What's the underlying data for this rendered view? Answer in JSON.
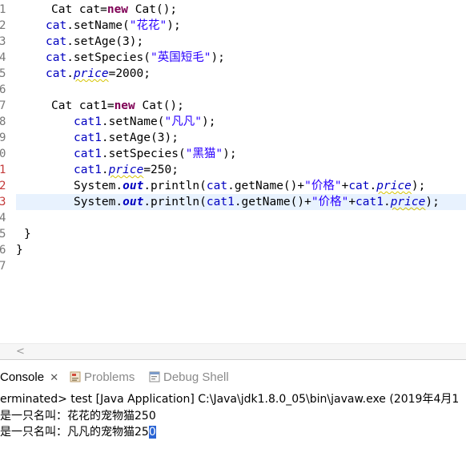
{
  "editor": {
    "lines": [
      {
        "num": "1",
        "numClass": "",
        "cur": false,
        "indent": 64,
        "segs": [
          {
            "t": "Cat cat=",
            "c": ""
          },
          {
            "t": "new",
            "c": "kw"
          },
          {
            "t": " Cat();",
            "c": ""
          }
        ]
      },
      {
        "num": "2",
        "numClass": "",
        "cur": false,
        "indent": 57,
        "segs": [
          {
            "t": "cat",
            "c": "fld"
          },
          {
            "t": ".setName(",
            "c": ""
          },
          {
            "t": "\"花花\"",
            "c": "str"
          },
          {
            "t": ");",
            "c": ""
          }
        ]
      },
      {
        "num": "3",
        "numClass": "",
        "cur": false,
        "indent": 57,
        "segs": [
          {
            "t": "cat",
            "c": "fld"
          },
          {
            "t": ".setAge(3);",
            "c": ""
          }
        ]
      },
      {
        "num": "4",
        "numClass": "",
        "cur": false,
        "indent": 57,
        "segs": [
          {
            "t": "cat",
            "c": "fld"
          },
          {
            "t": ".setSpecies(",
            "c": ""
          },
          {
            "t": "\"英国短毛\"",
            "c": "str"
          },
          {
            "t": ");",
            "c": ""
          }
        ]
      },
      {
        "num": "5",
        "numClass": "",
        "cur": false,
        "indent": 57,
        "segs": [
          {
            "t": "cat",
            "c": "fld"
          },
          {
            "t": ".",
            "c": ""
          },
          {
            "t": "price",
            "c": "fld ital sq"
          },
          {
            "t": "=2000;",
            "c": ""
          }
        ]
      },
      {
        "num": "6",
        "numClass": "",
        "cur": false,
        "indent": 0,
        "segs": []
      },
      {
        "num": "7",
        "numClass": "",
        "cur": false,
        "indent": 64,
        "segs": [
          {
            "t": "Cat cat1=",
            "c": ""
          },
          {
            "t": "new",
            "c": "kw"
          },
          {
            "t": " Cat();",
            "c": ""
          }
        ]
      },
      {
        "num": "8",
        "numClass": "",
        "cur": false,
        "indent": 92,
        "segs": [
          {
            "t": "cat1",
            "c": "fld"
          },
          {
            "t": ".setName(",
            "c": ""
          },
          {
            "t": "\"凡凡\"",
            "c": "str"
          },
          {
            "t": ");",
            "c": ""
          }
        ]
      },
      {
        "num": "9",
        "numClass": "",
        "cur": false,
        "indent": 92,
        "segs": [
          {
            "t": "cat1",
            "c": "fld"
          },
          {
            "t": ".setAge(3);",
            "c": ""
          }
        ]
      },
      {
        "num": "0",
        "numClass": "",
        "cur": false,
        "indent": 92,
        "segs": [
          {
            "t": "cat1",
            "c": "fld"
          },
          {
            "t": ".setSpecies(",
            "c": ""
          },
          {
            "t": "\"黑猫\"",
            "c": "str"
          },
          {
            "t": ");",
            "c": ""
          }
        ]
      },
      {
        "num": "1",
        "numClass": "err",
        "cur": false,
        "indent": 92,
        "segs": [
          {
            "t": "cat1",
            "c": "fld"
          },
          {
            "t": ".",
            "c": ""
          },
          {
            "t": "price",
            "c": "fld ital sq"
          },
          {
            "t": "=250;",
            "c": ""
          }
        ]
      },
      {
        "num": "2",
        "numClass": "err",
        "cur": false,
        "indent": 92,
        "segs": [
          {
            "t": "System.",
            "c": ""
          },
          {
            "t": "out",
            "c": "fld ital kwi"
          },
          {
            "t": ".println(",
            "c": ""
          },
          {
            "t": "cat",
            "c": "fld"
          },
          {
            "t": ".getName()+",
            "c": ""
          },
          {
            "t": "\"价格\"",
            "c": "str"
          },
          {
            "t": "+",
            "c": ""
          },
          {
            "t": "cat",
            "c": "fld"
          },
          {
            "t": ".",
            "c": ""
          },
          {
            "t": "price",
            "c": "fld ital sq"
          },
          {
            "t": ");",
            "c": ""
          }
        ]
      },
      {
        "num": "3",
        "numClass": "err",
        "cur": true,
        "indent": 92,
        "segs": [
          {
            "t": "System.",
            "c": ""
          },
          {
            "t": "out",
            "c": "fld ital kwi"
          },
          {
            "t": ".println(",
            "c": ""
          },
          {
            "t": "cat1",
            "c": "fld"
          },
          {
            "t": ".getName()+",
            "c": ""
          },
          {
            "t": "\"价格\"",
            "c": "str"
          },
          {
            "t": "+",
            "c": ""
          },
          {
            "t": "cat1",
            "c": "fld"
          },
          {
            "t": ".",
            "c": ""
          },
          {
            "t": "price",
            "c": "fld ital sq"
          },
          {
            "t": ");",
            "c": ""
          }
        ]
      },
      {
        "num": "4",
        "numClass": "",
        "cur": false,
        "indent": 0,
        "segs": []
      },
      {
        "num": "5",
        "numClass": "",
        "cur": false,
        "indent": 30,
        "segs": [
          {
            "t": "}",
            "c": ""
          }
        ]
      },
      {
        "num": "6",
        "numClass": "",
        "cur": false,
        "indent": 20,
        "segs": [
          {
            "t": "}",
            "c": ""
          }
        ]
      },
      {
        "num": "7",
        "numClass": "",
        "cur": false,
        "indent": 0,
        "segs": []
      }
    ]
  },
  "scrollbar": {
    "left_arrow": "<"
  },
  "tabs": {
    "console_label": "Console",
    "console_close": "✕",
    "problems_label": "Problems",
    "debug_shell_label": "Debug Shell"
  },
  "console": {
    "status": "erminated> test [Java Application] C:\\Java\\jdk1.8.0_05\\bin\\javaw.exe (2019年4月1",
    "output1": "是一只名叫：花花的宠物猫250",
    "output2_prefix": "是一只名叫：凡凡的宠物猫25",
    "output2_selected": "0"
  },
  "colors": {
    "keyword": "#7f0055",
    "field": "#0000c0",
    "string": "#2a00ff",
    "current_line": "#e8f2fe",
    "selection": "#2a64d4"
  }
}
